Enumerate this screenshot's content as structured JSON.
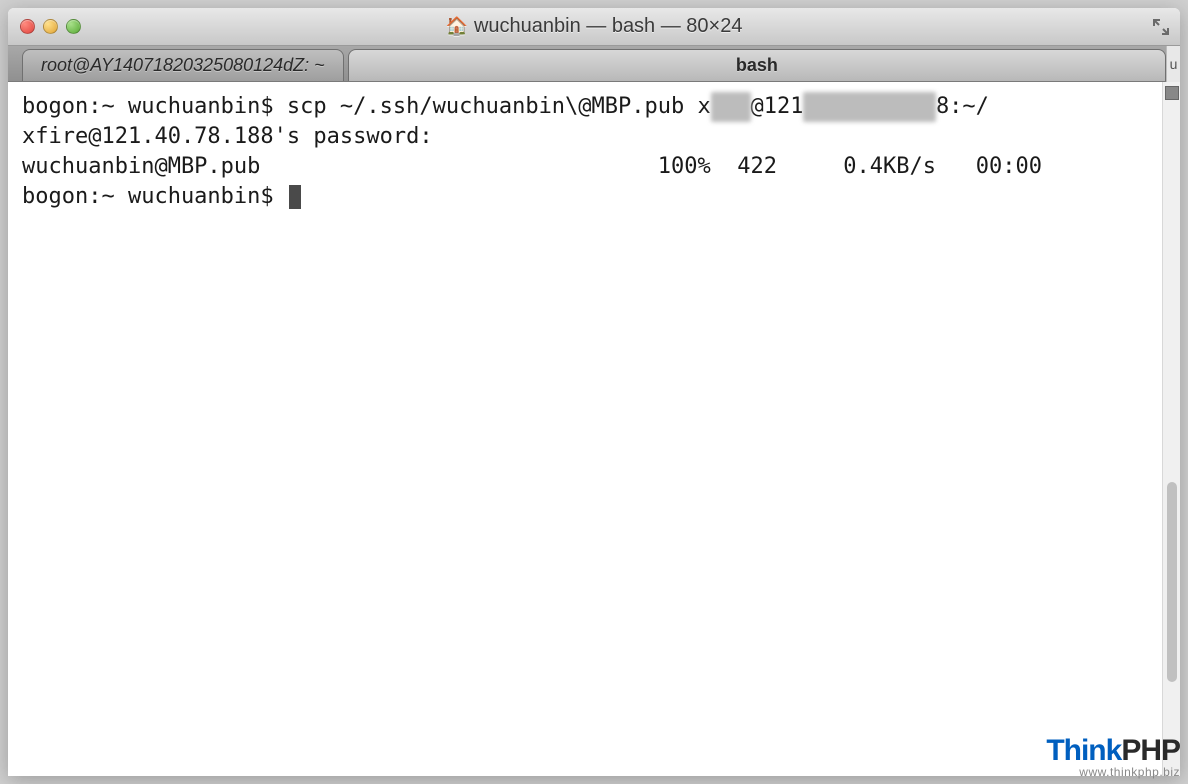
{
  "window": {
    "title": "wuchuanbin — bash — 80×24"
  },
  "tabs": {
    "inactive_label": "root@AY14071820325080124dZ: ~",
    "active_label": "bash"
  },
  "terminal": {
    "line1_prompt": "bogon:~ wuchuanbin$ ",
    "line1_cmd_a": "scp ~/.ssh/wuchuanbin\\@MBP.pub x",
    "line1_blur1": "███",
    "line1_cmd_b": "@121",
    "line1_blur2": "██████████",
    "line1_cmd_c": "8:~/",
    "line2": "xfire@121.40.78.188's password:",
    "line3_file": "wuchuanbin@MBP.pub",
    "line3_pct": "100%",
    "line3_size": "422",
    "line3_rate": "0.4KB/s",
    "line3_time": "00:00",
    "line4_prompt": "bogon:~ wuchuanbin$ "
  },
  "watermark": {
    "brand_a": "Think",
    "brand_b": "PHP",
    "url": "www.thinkphp.biz"
  }
}
